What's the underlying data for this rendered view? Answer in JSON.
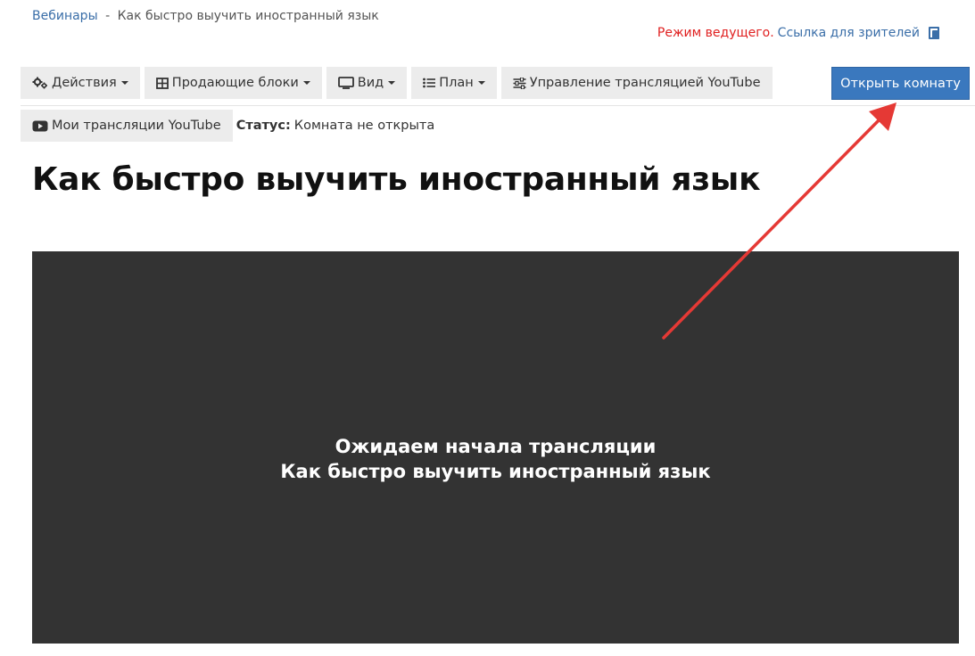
{
  "breadcrumb": {
    "parent": "Вебинары",
    "separator": "-",
    "current": "Как быстро выучить иностранный язык"
  },
  "host_bar": {
    "mode_text": "Режим ведущего.",
    "viewer_link": "Ссылка для зрителей",
    "icon": "copy-icon"
  },
  "toolbar": {
    "actions": {
      "label": "Действия",
      "icon": "gears-icon"
    },
    "selling_blocks": {
      "label": "Продающие блоки",
      "icon": "table-icon"
    },
    "view": {
      "label": "Вид",
      "icon": "monitor-icon"
    },
    "plan": {
      "label": "План",
      "icon": "list-icon"
    },
    "youtube_control": {
      "label": "Управление трансляцией YouTube",
      "icon": "sliders-icon"
    },
    "open_room": {
      "label": "Открыть комнату"
    }
  },
  "row2": {
    "my_broadcasts": {
      "label": "Мои трансляции YouTube",
      "icon": "youtube-icon"
    },
    "status_label": "Статус:",
    "status_value": "Комната не открыта"
  },
  "page_title": "Как быстро выучить иностранный язык",
  "video": {
    "line1": "Ожидаем начала трансляции",
    "line2": "Как быстро выучить иностранный язык"
  },
  "colors": {
    "link": "#3a6ea8",
    "host_mode": "#e01f1f",
    "primary_button": "#3a78be",
    "toolbar_button": "#ececec",
    "video_bg": "#333333",
    "annotation_arrow": "#e53935"
  }
}
